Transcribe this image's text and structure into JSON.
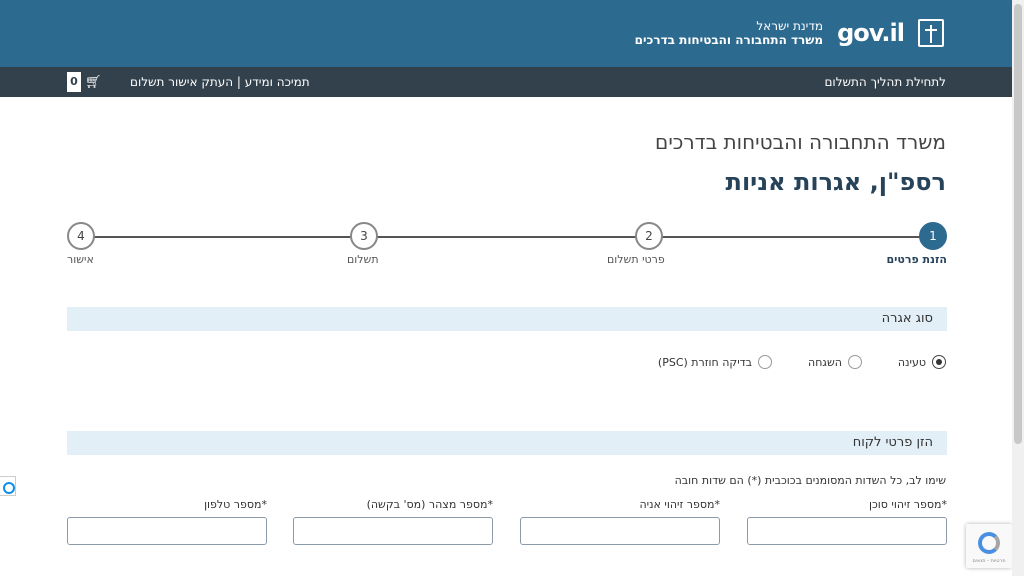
{
  "header": {
    "logo": "gov.il",
    "state_name": "מדינת ישראל",
    "ministry_name": "משרד התחבורה והבטיחות בדרכים"
  },
  "nav": {
    "start_link": "לתחילת תהליך התשלום",
    "links": "תמיכה ומידע | העתק אישור תשלום",
    "cart_count": "0"
  },
  "page": {
    "ministry_title": "משרד התחבורה והבטיחות בדרכים",
    "title": "רספ\"ן, אגרות אניות"
  },
  "stepper": {
    "steps": [
      {
        "number": "1",
        "label": "הזנת פרטים",
        "active": true
      },
      {
        "number": "2",
        "label": "פרטי תשלום",
        "active": false
      },
      {
        "number": "3",
        "label": "תשלום",
        "active": false
      },
      {
        "number": "4",
        "label": "אישור",
        "active": false
      }
    ]
  },
  "fee_type": {
    "header": "סוג אגרה",
    "options": [
      {
        "label": "טעינה",
        "selected": true
      },
      {
        "label": "השגחה",
        "selected": false
      },
      {
        "label": "בדיקה חוזרת (PSC)",
        "selected": false
      }
    ]
  },
  "customer": {
    "header": "הזן פרטי לקוח",
    "notice": "שימו לב, כל השדות המסומנים בכוכבית (*) הם שדות חובה",
    "fields": [
      {
        "label": "*מספר זיהוי סוכן",
        "value": ""
      },
      {
        "label": "*מספר זיהוי אניה",
        "value": ""
      },
      {
        "label": "*מספר מצהר (מס' בקשה)",
        "value": ""
      },
      {
        "label": "*מספר טלפון",
        "value": ""
      }
    ]
  },
  "recaptcha": {
    "text": "פרטיות - תנאים"
  },
  "colors": {
    "header_bg": "#2c6a8f",
    "nav_bg": "#33414c",
    "section_bg": "#e3eff7",
    "title": "#26435a"
  }
}
